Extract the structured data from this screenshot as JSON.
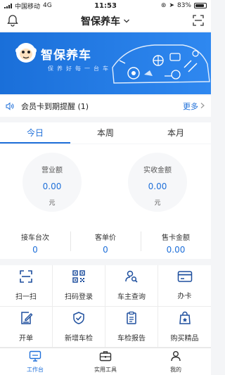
{
  "status_bar": {
    "carrier": "中国移动",
    "network": "4G",
    "time": "11:53",
    "battery": "83%",
    "battery_level": 0.83
  },
  "nav": {
    "title": "智保养车"
  },
  "banner": {
    "brand": "智保养车",
    "slogan": "保养好每一台车"
  },
  "notice": {
    "text": "会员卡到期提醒 (1)",
    "more": "更多"
  },
  "tabs": [
    {
      "label": "今日",
      "active": true
    },
    {
      "label": "本周",
      "active": false
    },
    {
      "label": "本月",
      "active": false
    }
  ],
  "stats": {
    "revenue": {
      "label": "营业额",
      "value": "0.00",
      "unit": "元"
    },
    "received": {
      "label": "实收金额",
      "value": "0.00",
      "unit": "元"
    },
    "vehicles": {
      "label": "接车台次",
      "value": "0"
    },
    "avg_price": {
      "label": "客单价",
      "value": "0"
    },
    "card_sales": {
      "label": "售卡金额",
      "value": "0.00"
    }
  },
  "tools": [
    {
      "label": "扫一扫",
      "icon": "scan-frame-icon"
    },
    {
      "label": "扫码登录",
      "icon": "qr-code-icon"
    },
    {
      "label": "车主查询",
      "icon": "user-search-icon"
    },
    {
      "label": "办卡",
      "icon": "card-icon"
    },
    {
      "label": "开单",
      "icon": "edit-document-icon"
    },
    {
      "label": "新增车检",
      "icon": "shield-check-icon"
    },
    {
      "label": "车检报告",
      "icon": "report-icon"
    },
    {
      "label": "购买精品",
      "icon": "shopping-bag-icon"
    }
  ],
  "tabbar": [
    {
      "label": "工作台",
      "icon": "monitor-icon",
      "active": true
    },
    {
      "label": "实用工具",
      "icon": "toolbox-icon",
      "active": false
    },
    {
      "label": "我的",
      "icon": "person-icon",
      "active": false
    }
  ],
  "colors": {
    "accent": "#1e6fd9",
    "banner": "#2f88f0"
  }
}
